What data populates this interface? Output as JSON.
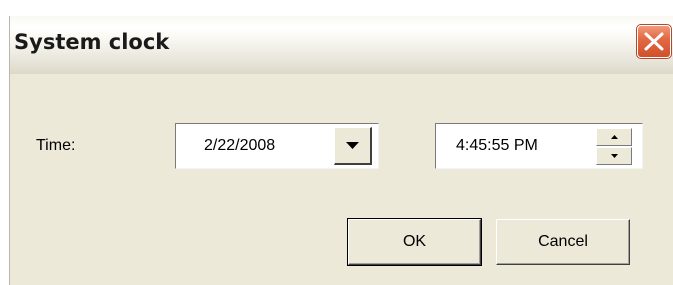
{
  "window": {
    "title": "System clock"
  },
  "form": {
    "time_label": "Time:",
    "date_value": "2/22/2008",
    "time_value": "4:45:55 PM"
  },
  "buttons": {
    "ok_label": "OK",
    "cancel_label": "Cancel"
  },
  "icons": {
    "close": "close-icon",
    "dropdown": "chevron-down-icon",
    "spin_up": "arrow-up-icon",
    "spin_down": "arrow-down-icon"
  },
  "colors": {
    "dialog_background": "#ece9d8",
    "close_button": "#e26a45"
  }
}
